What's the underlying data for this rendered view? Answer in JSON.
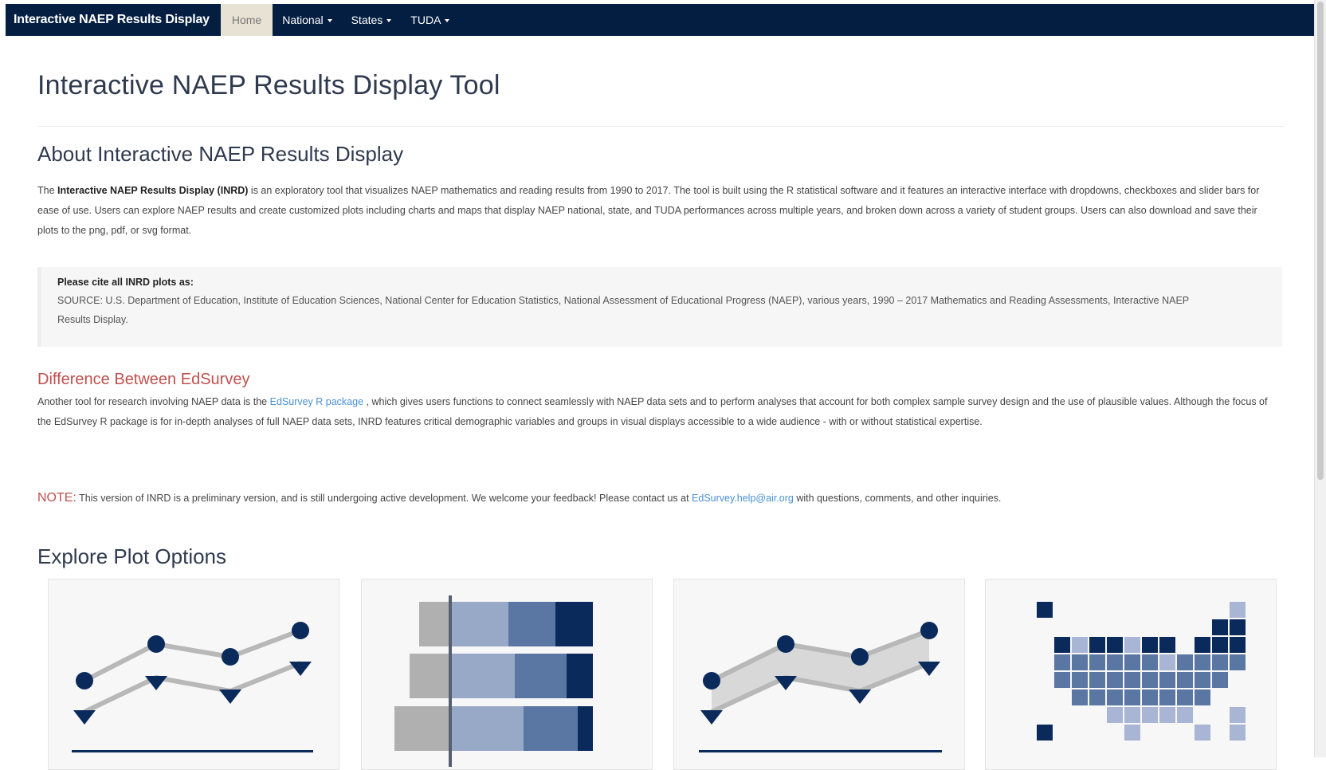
{
  "nav": {
    "brand": "Interactive NAEP Results Display",
    "items": [
      {
        "label": "Home",
        "dropdown": false,
        "active": true
      },
      {
        "label": "National",
        "dropdown": true,
        "active": false
      },
      {
        "label": "States",
        "dropdown": true,
        "active": false
      },
      {
        "label": "TUDA",
        "dropdown": true,
        "active": false
      }
    ]
  },
  "page": {
    "title": "Interactive NAEP Results Display Tool"
  },
  "about": {
    "heading": "About Interactive NAEP Results Display",
    "p_start": "The ",
    "p_bold": "Interactive NAEP Results Display (INRD)",
    "p_rest": " is an exploratory tool that visualizes NAEP mathematics and reading results from 1990 to 2017. The tool is built using the R statistical software and it features an interactive interface with dropdowns, checkboxes and slider bars for ease of use. Users can explore NAEP results and create customized plots including charts and maps that display NAEP national, state, and TUDA performances across multiple years, and broken down across a variety of student groups. Users can also download and save their plots to the png, pdf, or svg format."
  },
  "cite": {
    "heading": "Please cite all INRD plots as:",
    "text": "SOURCE: U.S. Department of Education, Institute of Education Sciences, National Center for Education Statistics, National Assessment of Educational Progress (NAEP), various years, 1990 – 2017 Mathematics and Reading Assessments, Interactive NAEP Results Display."
  },
  "difference": {
    "heading": "Difference Between EdSurvey",
    "p_start": "Another tool for research involving NAEP data is the ",
    "link": "EdSurvey R package",
    "p_rest": " , which gives users functions to connect seamlessly with NAEP data sets and to perform analyses that account for both complex sample survey design and the use of plausible values. Although the focus of the EdSurvey R package is for in-depth analyses of full NAEP data sets, INRD features critical demographic variables and groups in visual displays accessible to a wide audience - with or without statistical expertise."
  },
  "note": {
    "label": "NOTE:",
    "text_start": " This version of INRD is a preliminary version, and is still undergoing active development. We welcome your feedback! Please contact us at ",
    "email": "EdSurvey.help@air.org",
    "text_end": " with questions, comments, and other inquiries."
  },
  "explore": {
    "heading": "Explore Plot Options"
  },
  "colors": {
    "navbar": "#041e42",
    "accent_red": "#c0504d",
    "link_blue": "#4a90d9",
    "navy": "#0a2a5c",
    "mid_blue": "#5a76a3",
    "light_blue": "#98a9c8",
    "gray": "#b0b0b0"
  },
  "cards": [
    {
      "icon": "line-plot-icon"
    },
    {
      "icon": "stacked-bar-plot-icon"
    },
    {
      "icon": "gap-plot-icon"
    },
    {
      "icon": "us-map-plot-icon"
    }
  ]
}
